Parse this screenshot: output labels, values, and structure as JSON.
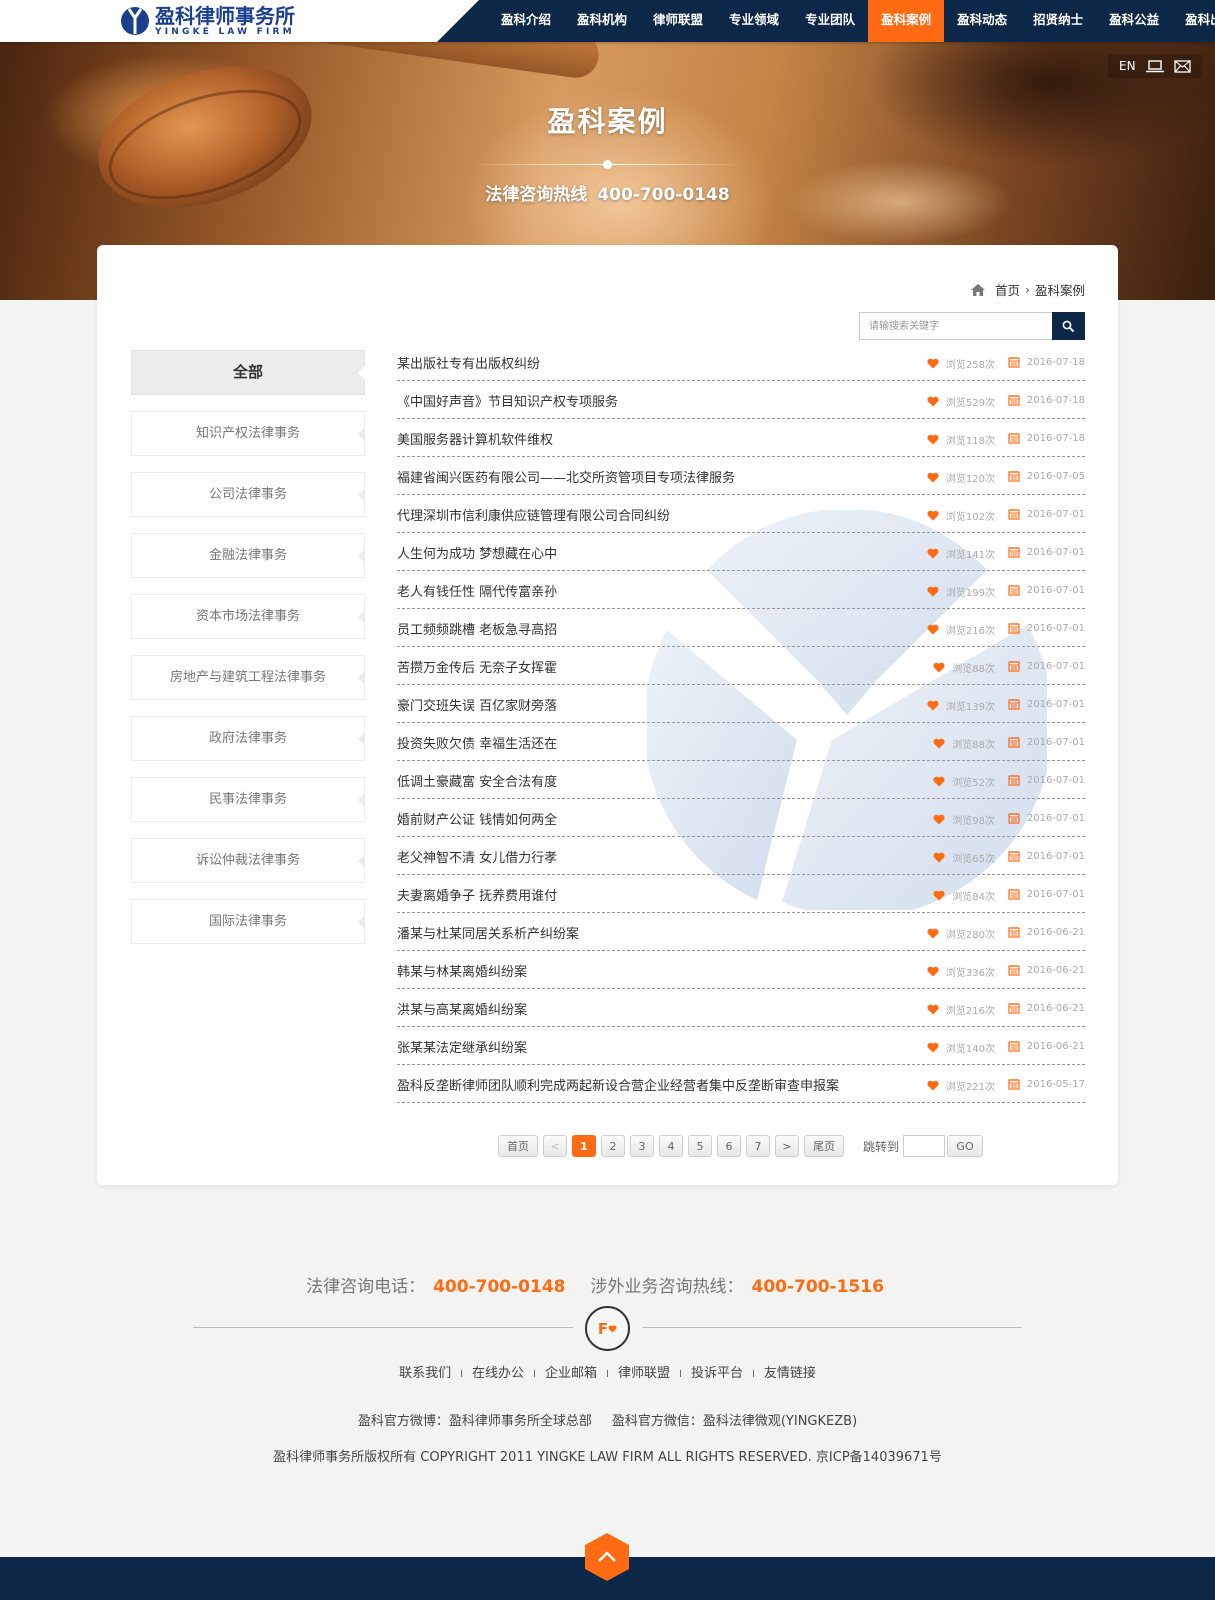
{
  "brand": {
    "name_cn": "盈科律师事务所",
    "name_en": "YINGKE LAW FIRM",
    "brand_color": "#1b3f8f"
  },
  "nav": {
    "items": [
      {
        "label": "盈科介绍"
      },
      {
        "label": "盈科机构"
      },
      {
        "label": "律师联盟"
      },
      {
        "label": "专业领域"
      },
      {
        "label": "专业团队"
      },
      {
        "label": "盈科案例"
      },
      {
        "label": "盈科动态"
      },
      {
        "label": "招贤纳士"
      },
      {
        "label": "盈科公益"
      },
      {
        "label": "盈科出版"
      }
    ],
    "active": "盈科案例",
    "bg_color": "#0d2748",
    "accent_color": "#ff6a13"
  },
  "banner": {
    "title": "盈科案例",
    "hotline_label": "法律咨询热线",
    "hotline_number": "400-700-0148",
    "tools": {
      "lang": "EN",
      "icons": [
        "monitor-icon",
        "mail-icon"
      ]
    }
  },
  "breadcrumb": {
    "home": "首页",
    "sep": "›",
    "current": "盈科案例"
  },
  "search": {
    "placeholder": "请输搜索关键字",
    "value": ""
  },
  "sidebar": {
    "items": [
      {
        "label": "全部",
        "active": true
      },
      {
        "label": "知识产权法律事务"
      },
      {
        "label": "公司法律事务"
      },
      {
        "label": "金融法律事务"
      },
      {
        "label": "资本市场法律事务"
      },
      {
        "label": "房地产与建筑工程法律事务"
      },
      {
        "label": "政府法律事务"
      },
      {
        "label": "民事法律事务"
      },
      {
        "label": "诉讼仲裁法律事务"
      },
      {
        "label": "国际法律事务"
      }
    ]
  },
  "cases": [
    {
      "title": "某出版社专有出版权纠纷",
      "views": "浏览258次",
      "date": "2016-07-18"
    },
    {
      "title": "《中国好声音》节目知识产权专项服务",
      "views": "浏览529次",
      "date": "2016-07-18"
    },
    {
      "title": "美国服务器计算机软件维权",
      "views": "浏览118次",
      "date": "2016-07-18"
    },
    {
      "title": "福建省闽兴医药有限公司——北交所资管项目专项法律服务",
      "views": "浏览120次",
      "date": "2016-07-05"
    },
    {
      "title": "代理深圳市信利康供应链管理有限公司合同纠纷",
      "views": "浏览102次",
      "date": "2016-07-01"
    },
    {
      "title": "人生何为成功 梦想藏在心中",
      "views": "浏览141次",
      "date": "2016-07-01"
    },
    {
      "title": "老人有钱任性 隔代传富亲孙",
      "views": "浏览199次",
      "date": "2016-07-01"
    },
    {
      "title": "员工频频跳槽 老板急寻高招",
      "views": "浏览216次",
      "date": "2016-07-01"
    },
    {
      "title": "苦攒万金传后 无奈子女挥霍",
      "views": "浏览88次",
      "date": "2016-07-01"
    },
    {
      "title": "豪门交班失误 百亿家财旁落",
      "views": "浏览139次",
      "date": "2016-07-01"
    },
    {
      "title": "投资失败欠债 幸福生活还在",
      "views": "浏览88次",
      "date": "2016-07-01"
    },
    {
      "title": "低调土豪藏富 安全合法有度",
      "views": "浏览52次",
      "date": "2016-07-01"
    },
    {
      "title": "婚前财产公证 钱情如何两全",
      "views": "浏览98次",
      "date": "2016-07-01"
    },
    {
      "title": "老父神智不清 女儿借力行孝",
      "views": "浏览65次",
      "date": "2016-07-01"
    },
    {
      "title": "夫妻离婚争子 抚养费用谁付",
      "views": "浏览84次",
      "date": "2016-07-01"
    },
    {
      "title": "潘某与杜某同居关系析产纠纷案",
      "views": "浏览280次",
      "date": "2016-06-21"
    },
    {
      "title": "韩某与林某离婚纠纷案",
      "views": "浏览336次",
      "date": "2016-06-21"
    },
    {
      "title": "洪某与高某离婚纠纷案",
      "views": "浏览216次",
      "date": "2016-06-21"
    },
    {
      "title": "张某某法定继承纠纷案",
      "views": "浏览140次",
      "date": "2016-06-21"
    },
    {
      "title": "盈科反垄断律师团队顺利完成两起新设合营企业经营者集中反垄断审查申报案",
      "views": "浏览221次",
      "date": "2016-05-17"
    }
  ],
  "pagination": {
    "first": "首页",
    "prev": "<",
    "pages": [
      "1",
      "2",
      "3",
      "4",
      "5",
      "6",
      "7"
    ],
    "current": "1",
    "next": ">",
    "last": "尾页",
    "jump_label": "跳转到",
    "go": "GO"
  },
  "footer": {
    "consult_label": "法律咨询电话：",
    "consult_number": "400-700-0148",
    "foreign_label": "涉外业务咨询热线：",
    "foreign_number": "400-700-1516",
    "emblem": "F",
    "links": [
      "联系我们",
      "在线办公",
      "企业邮箱",
      "律师联盟",
      "投诉平台",
      "友情链接"
    ],
    "link_sep": "I",
    "weibo": "盈科官方微博：盈科律师事务所全球总部",
    "wechat": "盈科官方微信：盈科法律微观(YINGKEZB)",
    "copyright": "盈科律师事务所版权所有 COPYRIGHT 2011 YINGKE LAW FIRM ALL RIGHTS RESERVED. 京ICP备14039671号"
  }
}
